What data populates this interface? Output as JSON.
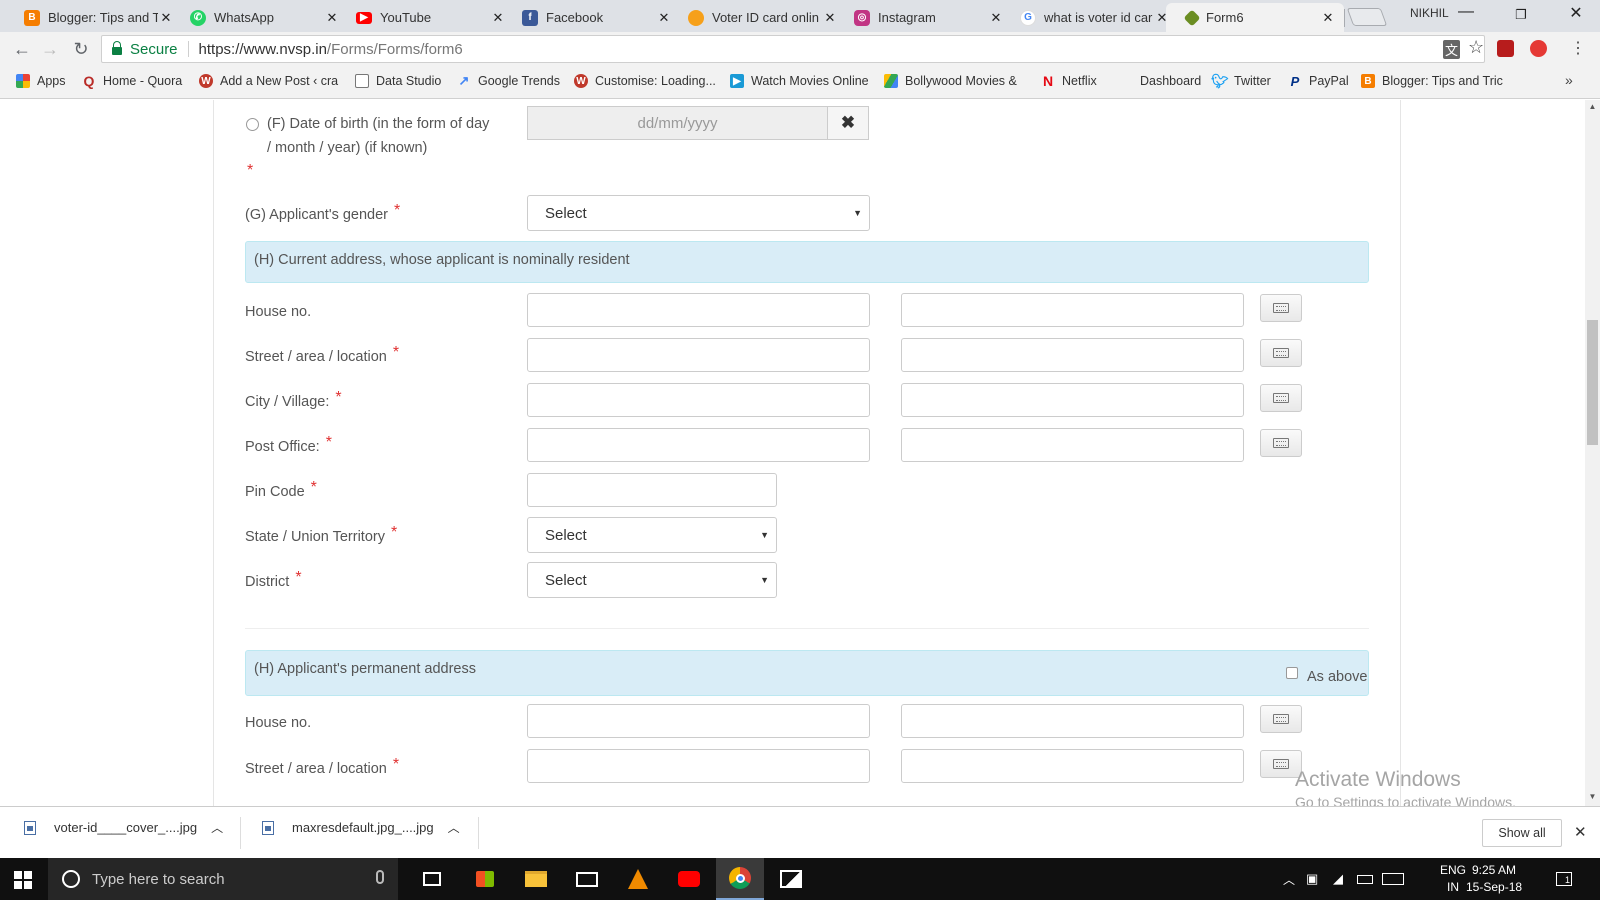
{
  "browser": {
    "tabs": [
      {
        "title": "Blogger: Tips and T",
        "favicon": "blogger-icon",
        "color": "#f57d00"
      },
      {
        "title": "WhatsApp",
        "favicon": "whatsapp-icon",
        "color": "#25d366"
      },
      {
        "title": "YouTube",
        "favicon": "youtube-icon",
        "color": "#ff0000"
      },
      {
        "title": "Facebook",
        "favicon": "facebook-icon",
        "color": "#3b5998"
      },
      {
        "title": "Voter ID card onlin",
        "favicon": "orange-dot-icon",
        "color": "#f6a01a"
      },
      {
        "title": "Instagram",
        "favicon": "instagram-icon",
        "color": "#c13584"
      },
      {
        "title": "what is voter id car",
        "favicon": "google-icon",
        "color": "#4285f4"
      },
      {
        "title": "Form6",
        "favicon": "nvsp-icon",
        "color": "#6b8e23"
      }
    ],
    "profile_name": "NIKHIL",
    "secure_label": "Secure",
    "url_host": "https://www.nvsp.in",
    "url_path": "/Forms/Forms/form6",
    "bookmarks": [
      {
        "label": "Apps",
        "icon": "apps-grid-icon",
        "color": "#e94235"
      },
      {
        "label": "Home - Quora",
        "icon": "quora-icon",
        "color": "#b92b27"
      },
      {
        "label": "Add a New Post ‹ cra",
        "icon": "wordpress-icon",
        "color": "#c0392b"
      },
      {
        "label": "Data Studio",
        "icon": "page-icon",
        "color": "#777777"
      },
      {
        "label": "Google Trends",
        "icon": "trends-icon",
        "color": "#4285f4"
      },
      {
        "label": "Customise: Loading...",
        "icon": "wordpress-icon",
        "color": "#c0392b"
      },
      {
        "label": "Watch Movies Online",
        "icon": "play-icon",
        "color": "#1a9ad6"
      },
      {
        "label": "Bollywood Movies &",
        "icon": "drive-icon",
        "color": "#34a853"
      },
      {
        "label": "Netflix",
        "icon": "netflix-icon",
        "color": "#e50914"
      },
      {
        "label": "Dashboard",
        "icon": "none",
        "color": "#ffffff"
      },
      {
        "label": "Twitter",
        "icon": "twitter-icon",
        "color": "#1da1f2"
      },
      {
        "label": "PayPal",
        "icon": "paypal-icon",
        "color": "#003087"
      },
      {
        "label": "Blogger: Tips and Tric",
        "icon": "blogger-icon",
        "color": "#f57d00"
      }
    ]
  },
  "form": {
    "dob_label_line1": "(F) Date of birth (in the form of day",
    "dob_label_line2": "/ month / year) (if known)",
    "dob_placeholder": "dd/mm/yyyy",
    "clear_symbol": "✖",
    "gender_label": "(G) Applicant's gender",
    "gender_value": "Select",
    "current_address_heading": "(H) Current address, whose applicant is nominally resident",
    "house_no_label": "House no.",
    "street_label": "Street / area / location",
    "city_label": "City / Village:",
    "post_office_label": "Post Office:",
    "pin_code_label": "Pin Code",
    "state_label": "State / Union Territory",
    "state_value": "Select",
    "district_label": "District",
    "district_value": "Select",
    "permanent_address_heading": "(H) Applicant's permanent address",
    "as_above_label": "As above",
    "perm_house_no_label": "House no.",
    "perm_street_label": "Street / area / location",
    "required_mark": "*"
  },
  "watermark": {
    "line1": "Activate Windows",
    "line2": "Go to Settings to activate Windows."
  },
  "downloads": {
    "items": [
      {
        "name": "voter-id____cover_....jpg"
      },
      {
        "name": "maxresdefault.jpg_....jpg"
      }
    ],
    "show_all_label": "Show all"
  },
  "taskbar": {
    "search_placeholder": "Type here to search",
    "language_line1": "ENG",
    "language_line2": "IN",
    "time": "9:25 AM",
    "date": "15-Sep-18",
    "notification_count": "1"
  }
}
